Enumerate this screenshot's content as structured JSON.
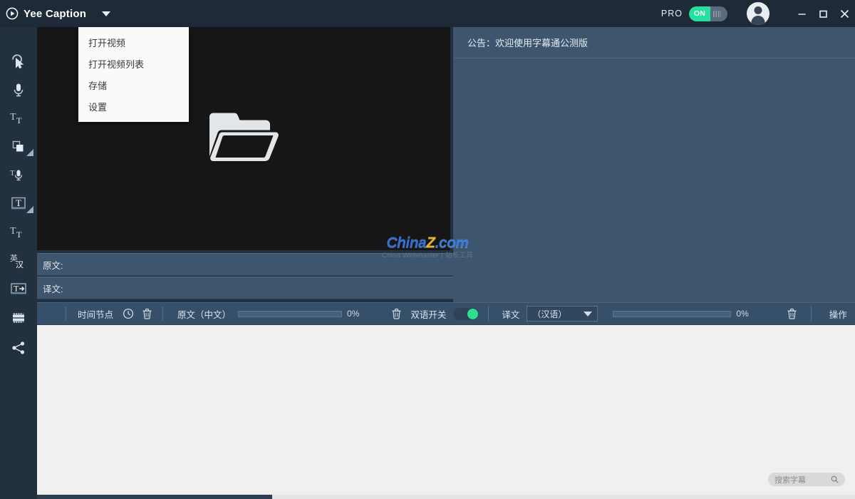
{
  "window": {
    "app_title": "Yee Caption",
    "logo_icon": "play-circle-icon",
    "menu_caret_icon": "chevron-down-icon",
    "pro_label": "PRO",
    "pro_toggle_state": "ON",
    "avatar_icon": "user-avatar-icon",
    "minimize_icon": "minimize-icon",
    "maximize_icon": "maximize-icon",
    "close_icon": "close-icon",
    "accent_green": "#25e0a0",
    "titlebar_bg": "#1e2a38"
  },
  "dropdown_menu": {
    "visible": true,
    "items": [
      {
        "label": "打开视频",
        "name": "menu-item-open-video"
      },
      {
        "label": "打开视频列表",
        "name": "menu-item-open-video-list"
      },
      {
        "label": "存储",
        "name": "menu-item-save"
      },
      {
        "label": "设置",
        "name": "menu-item-settings"
      }
    ]
  },
  "sidebar": {
    "items": [
      {
        "icon": "cursor-select-icon",
        "name": "tool-select"
      },
      {
        "icon": "microphone-icon",
        "name": "tool-record-audio"
      },
      {
        "icon": "text-size-icon",
        "name": "tool-text-size"
      },
      {
        "icon": "shape-square-icon",
        "name": "tool-shape",
        "has_submenu": true
      },
      {
        "icon": "text-to-speech-icon",
        "name": "tool-text-to-speech"
      },
      {
        "icon": "text-box-icon",
        "name": "tool-text-box",
        "has_submenu": true
      },
      {
        "icon": "text-style-icon",
        "name": "tool-text-style"
      },
      {
        "icon": "translate-cn-en-icon",
        "name": "tool-translate"
      },
      {
        "icon": "text-export-icon",
        "name": "tool-text-export"
      },
      {
        "icon": "film-strip-icon",
        "name": "tool-video-track"
      },
      {
        "icon": "share-icon",
        "name": "tool-share"
      }
    ]
  },
  "video_panel": {
    "folder_icon": "open-folder-icon",
    "bg_color": "#161616"
  },
  "watermark": {
    "brand_china": "China",
    "brand_z": "Z",
    "brand_com": ".com",
    "subtitle": "China Webmaster | 站长工具"
  },
  "right_panel": {
    "announcement": "公告：欢迎使用字幕通公测版",
    "bg_color": "#3d566e"
  },
  "editor_rows": {
    "source_label": "原文:",
    "source_value": "",
    "translation_label": "译文:",
    "translation_value": ""
  },
  "control_bar": {
    "timeline_label": "时间节点",
    "clock_icon": "clock-icon",
    "delete_timeline_icon": "trash-icon",
    "source_label": "原文（中文）",
    "source_progress_pct": "0%",
    "source_progress_value": 0,
    "delete_source_icon": "trash-icon",
    "bilingual_label": "双语开关",
    "bilingual_state": "on",
    "translation_label": "译文",
    "language_select_value": "（汉语）",
    "language_caret_icon": "chevron-down-icon",
    "translation_progress_pct": "0%",
    "translation_progress_value": 0,
    "delete_translation_icon": "trash-icon",
    "actions_label": "操作"
  },
  "subtitle_list": {
    "rows": [],
    "search_placeholder": "搜索字幕",
    "search_value": "",
    "search_icon": "search-icon",
    "bg_color": "#f0f0ee"
  }
}
